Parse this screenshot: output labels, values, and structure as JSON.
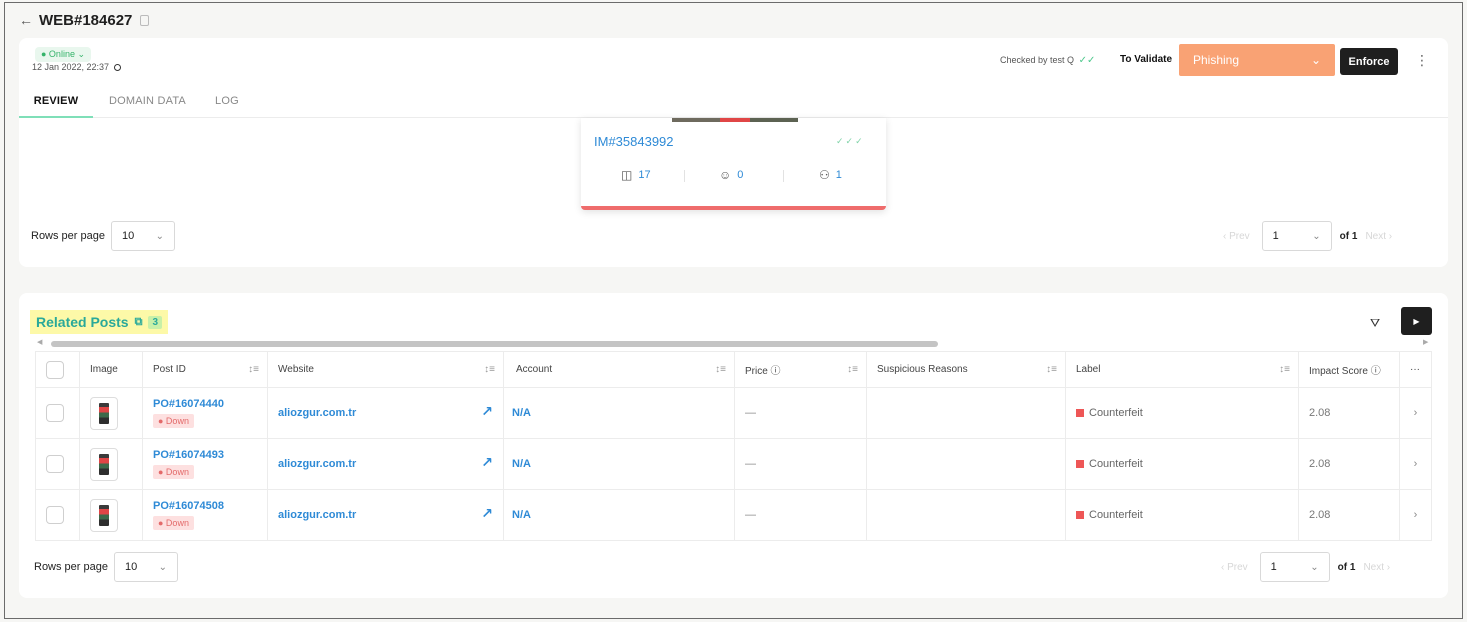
{
  "header": {
    "back_icon": "arrow-left-icon",
    "back": "←",
    "title": "WEB#184627",
    "copy_icon": "copy-icon"
  },
  "status": {
    "online": "● Online ⌄",
    "date": "12 Jan 2022, 22:37",
    "clock_icon": "clock-icon"
  },
  "tabs": [
    {
      "label": "REVIEW",
      "active": true
    },
    {
      "label": "DOMAIN DATA",
      "active": false
    },
    {
      "label": "LOG",
      "active": false
    }
  ],
  "review": {
    "checked_by": "Checked by test Q",
    "checked_ticks": "✓✓",
    "to_validate": "To Validate",
    "label_select": "Phishing",
    "label_chevron": "⌄",
    "enforce": "Enforce",
    "more": "⋮",
    "phishing_color": "#f9a274"
  },
  "image_card": {
    "id": "IM#35843992",
    "ticks": "✓✓✓",
    "stats": [
      {
        "icon": "panel-icon",
        "glyph": "◫",
        "value": "17"
      },
      {
        "icon": "user-circle-icon",
        "glyph": "☺",
        "value": "0"
      },
      {
        "icon": "user-lock-icon",
        "glyph": "⚇",
        "value": "1"
      }
    ]
  },
  "pagination_top": {
    "rows_label": "Rows per page",
    "rows_value": "10",
    "prev": "‹ Prev",
    "page": "1",
    "of": "of 1",
    "next": "Next ›"
  },
  "related": {
    "title": "Related Posts",
    "ext_glyph": "⧉",
    "count": "3",
    "filter_glyph": "⛛",
    "play_glyph": "▶",
    "columns": [
      {
        "label": "",
        "sortable": false
      },
      {
        "label": "Image",
        "sortable": false
      },
      {
        "label": "Post ID",
        "sortable": true
      },
      {
        "label": "Website",
        "sortable": true
      },
      {
        "label": "Account",
        "sortable": true
      },
      {
        "label": "Price ⓘ",
        "sortable": true
      },
      {
        "label": "Suspicious Reasons",
        "sortable": true
      },
      {
        "label": "Label",
        "sortable": true
      },
      {
        "label": "Impact Score ⓘ",
        "sortable": false
      },
      {
        "label": "···",
        "sortable": false
      }
    ],
    "sort_glyph": "↕≡",
    "rows": [
      {
        "post_id": "PO#16074440",
        "status": "● Down",
        "website": "aliozgur.com.tr",
        "ext": "↗",
        "account": "N/A",
        "price": "—",
        "reasons": "",
        "label": "Counterfeit",
        "score": "2.08",
        "chev": "›"
      },
      {
        "post_id": "PO#16074493",
        "status": "● Down",
        "website": "aliozgur.com.tr",
        "ext": "↗",
        "account": "N/A",
        "price": "—",
        "reasons": "",
        "label": "Counterfeit",
        "score": "2.08",
        "chev": "›"
      },
      {
        "post_id": "PO#16074508",
        "status": "● Down",
        "website": "aliozgur.com.tr",
        "ext": "↗",
        "account": "N/A",
        "price": "—",
        "reasons": "",
        "label": "Counterfeit",
        "score": "2.08",
        "chev": "›"
      }
    ]
  },
  "pagination_bottom": {
    "rows_label": "Rows per page",
    "rows_value": "10",
    "prev": "‹ Prev",
    "page": "1",
    "of": "of 1",
    "next": "Next ›"
  },
  "colors": {
    "accent_teal": "#2aa99a",
    "link_blue": "#2e8ad6",
    "counterfeit_red": "#ee5656",
    "online_green": "#35b36a"
  }
}
